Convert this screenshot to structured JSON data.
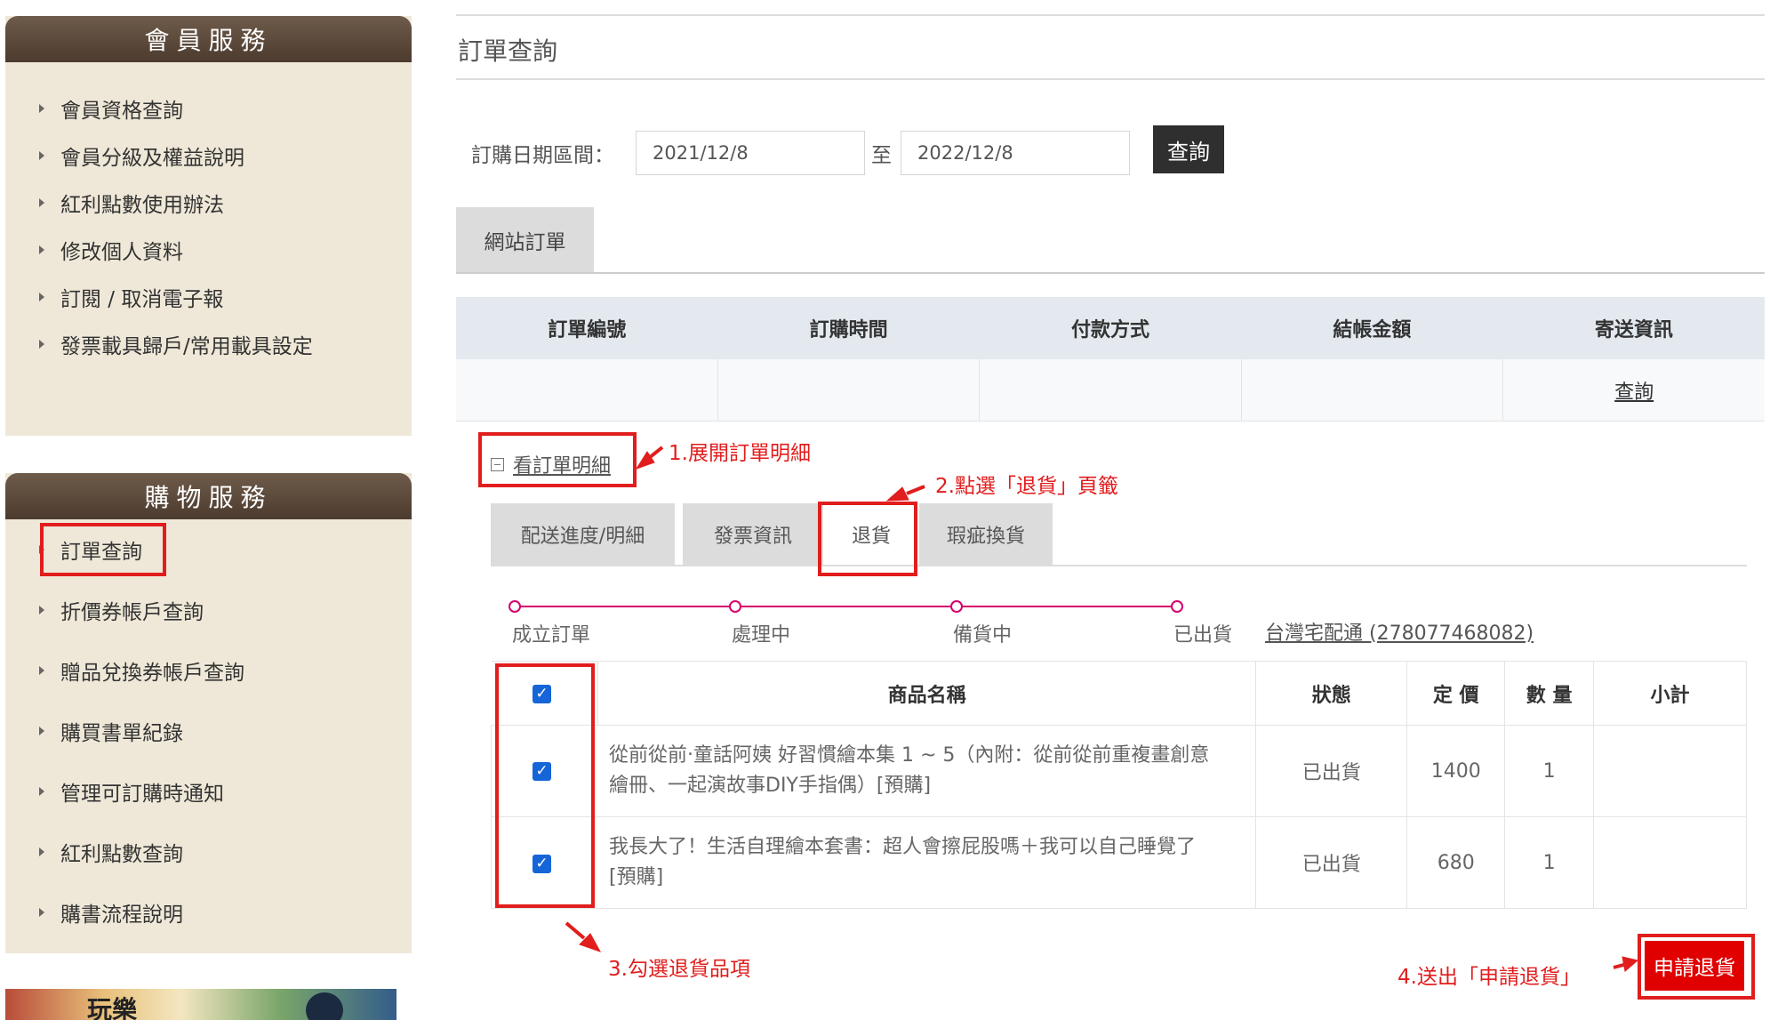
{
  "sidebar": {
    "member_service": {
      "title": "會員服務",
      "items": [
        "會員資格查詢",
        "會員分級及權益說明",
        "紅利點數使用辦法",
        "修改個人資料",
        "訂閱 / 取消電子報",
        "發票載具歸戶/常用載具設定"
      ]
    },
    "shopping_service": {
      "title": "購物服務",
      "items": [
        "訂單查詢",
        "折價券帳戶查詢",
        "贈品兌換券帳戶查詢",
        "購買書單紀錄",
        "管理可訂購時通知",
        "紅利點數查詢",
        "購書流程說明"
      ]
    },
    "banner_text": "玩樂"
  },
  "main": {
    "title": "訂單查詢",
    "date_filter": {
      "label": "訂購日期區間：",
      "from": "2021/12/8",
      "to_label": "至",
      "to": "2022/12/8",
      "button": "查詢"
    },
    "tab_web_orders": "網站訂單",
    "order_table": {
      "headers": [
        "訂單編號",
        "訂購時間",
        "付款方式",
        "結帳金額",
        "寄送資訊"
      ],
      "row": [
        "",
        "",
        "",
        "",
        "查詢"
      ]
    },
    "view_detail": "看訂單明細",
    "sub_tabs": [
      "配送進度/明細",
      "發票資訊",
      "退貨",
      "瑕疵換貨"
    ],
    "progress": {
      "steps": [
        "成立訂單",
        "處理中",
        "備貨中",
        "已出貨"
      ],
      "shipping": "台灣宅配通 (278077468082)"
    },
    "items_table": {
      "headers": [
        "",
        "商品名稱",
        "狀態",
        "定 價",
        "數 量",
        "小計"
      ],
      "rows": [
        {
          "name_line1": "從前從前‧童話阿姨 好習慣繪本集 1 ~ 5（內附：從前從前重複畫創意",
          "name_line2": "繪冊、一起演故事DIY手指偶）[預購]",
          "status": "已出貨",
          "price": "1400",
          "qty": "1",
          "subtotal": ""
        },
        {
          "name_line1": "我長大了！生活自理繪本套書：超人會擦屁股嗎＋我可以自己睡覺了",
          "name_line2": "[預購]",
          "status": "已出貨",
          "price": "680",
          "qty": "1",
          "subtotal": ""
        }
      ]
    },
    "return_button": "申請退貨"
  },
  "annotations": {
    "step1": "1.展開訂單明細",
    "step2": "2.點選「退貨」頁籤",
    "step3": "3.勾選退貨品項",
    "step4": "4.送出「申請退貨」",
    "color": "#e11d1d"
  }
}
